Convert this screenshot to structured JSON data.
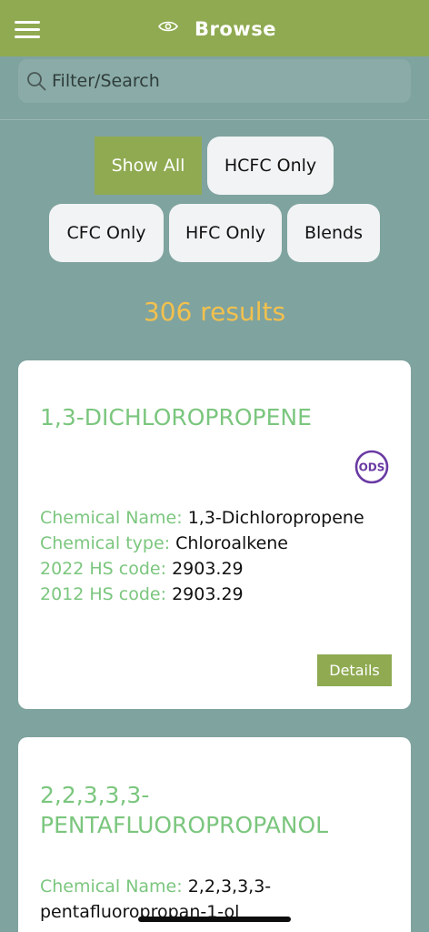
{
  "header": {
    "title": "Browse",
    "menu_icon": "hamburger-menu-icon",
    "eye_icon": "eye-icon"
  },
  "search": {
    "placeholder": "Filter/Search",
    "value": ""
  },
  "filters": {
    "show_all": "Show All",
    "hcfc_only": "HCFC Only",
    "cfc_only": "CFC Only",
    "hfc_only": "HFC Only",
    "blends": "Blends",
    "active": "Show All"
  },
  "results": {
    "count_label": "306 results"
  },
  "cards": [
    {
      "title": "1,3-DICHLOROPROPENE",
      "badge": "ODS",
      "fields": [
        {
          "label": "Chemical Name:",
          "value": "1,3-Dichloropropene"
        },
        {
          "label": "Chemical type:",
          "value": "Chloroalkene"
        },
        {
          "label": "2022 HS code:",
          "value": "2903.29"
        },
        {
          "label": "2012 HS code:",
          "value": "2903.29"
        }
      ],
      "details_label": "Details"
    },
    {
      "title_line1": "2,2,3,3,3-",
      "title_line2": "PENTAFLUOROPROPANOL",
      "fields": [
        {
          "label": "Chemical Name:",
          "value_line1": "2,2,3,3,3-",
          "value_line2": "pentafluoropropan-1-ol"
        }
      ]
    }
  ],
  "colors": {
    "header_bg": "#8faa51",
    "page_bg": "#7fa39f",
    "accent_green": "#7bc67e",
    "results_yellow": "#f2c14e",
    "badge_purple": "#6a3aa3"
  }
}
